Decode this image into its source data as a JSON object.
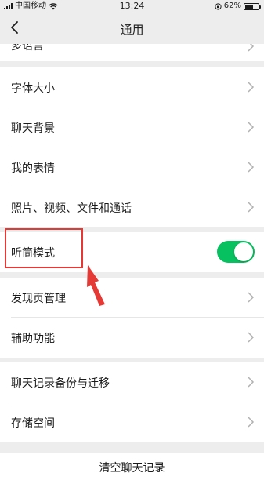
{
  "status_bar": {
    "carrier": "中国移动",
    "time": "13:24",
    "battery_percent": "62%",
    "battery_level": 0.62
  },
  "nav": {
    "title": "通用",
    "back_icon": "chevron-left-icon"
  },
  "partial_top_item": "多语言",
  "items": [
    {
      "label": "字体大小"
    },
    {
      "label": "聊天背景"
    },
    {
      "label": "我的表情"
    },
    {
      "label": "照片、视频、文件和通话"
    },
    {
      "label": "听筒模式",
      "toggle_on": true
    },
    {
      "label": "发现页管理"
    },
    {
      "label": "辅助功能"
    },
    {
      "label": "聊天记录备份与迁移"
    },
    {
      "label": "存储空间"
    }
  ],
  "clear_button": "清空聊天记录",
  "colors": {
    "toggle_on": "#07c160",
    "annotation": "#e53935",
    "background": "#ededed"
  }
}
